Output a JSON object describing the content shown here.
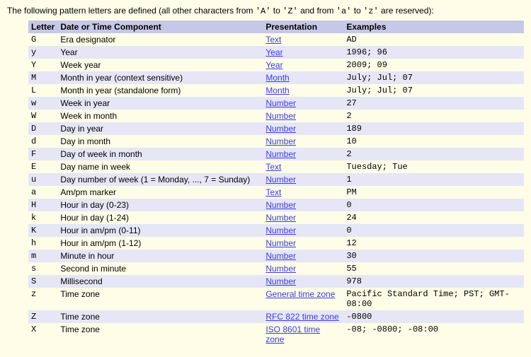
{
  "intro": {
    "prefix": "The following pattern letters are defined (all other characters from ",
    "code1": "'A'",
    "mid1": " to ",
    "code2": "'Z'",
    "mid2": " and from ",
    "code3": "'a'",
    "mid3": " to ",
    "code4": "'z'",
    "suffix": " are reserved):"
  },
  "headers": {
    "letter": "Letter",
    "desc": "Date or Time Component",
    "pres": "Presentation",
    "ex": "Examples"
  },
  "rows": [
    {
      "letter": "G",
      "desc": "Era designator",
      "pres": "Text",
      "ex": "AD"
    },
    {
      "letter": "y",
      "desc": "Year",
      "pres": "Year",
      "ex": "1996; 96"
    },
    {
      "letter": "Y",
      "desc": "Week year",
      "pres": "Year",
      "ex": "2009; 09"
    },
    {
      "letter": "M",
      "desc": "Month in year (context sensitive)",
      "pres": "Month",
      "ex": "July; Jul; 07"
    },
    {
      "letter": "L",
      "desc": "Month in year (standalone form)",
      "pres": "Month",
      "ex": "July; Jul; 07"
    },
    {
      "letter": "w",
      "desc": "Week in year",
      "pres": "Number",
      "ex": "27"
    },
    {
      "letter": "W",
      "desc": "Week in month",
      "pres": "Number",
      "ex": "2"
    },
    {
      "letter": "D",
      "desc": "Day in year",
      "pres": "Number",
      "ex": "189"
    },
    {
      "letter": "d",
      "desc": "Day in month",
      "pres": "Number",
      "ex": "10"
    },
    {
      "letter": "F",
      "desc": "Day of week in month",
      "pres": "Number",
      "ex": "2"
    },
    {
      "letter": "E",
      "desc": "Day name in week",
      "pres": "Text",
      "ex": "Tuesday; Tue"
    },
    {
      "letter": "u",
      "desc": "Day number of week (1 = Monday, ..., 7 = Sunday)",
      "pres": "Number",
      "ex": "1"
    },
    {
      "letter": "a",
      "desc": "Am/pm marker",
      "pres": "Text",
      "ex": "PM"
    },
    {
      "letter": "H",
      "desc": "Hour in day (0-23)",
      "pres": "Number",
      "ex": "0"
    },
    {
      "letter": "k",
      "desc": "Hour in day (1-24)",
      "pres": "Number",
      "ex": "24"
    },
    {
      "letter": "K",
      "desc": "Hour in am/pm (0-11)",
      "pres": "Number",
      "ex": "0"
    },
    {
      "letter": "h",
      "desc": "Hour in am/pm (1-12)",
      "pres": "Number",
      "ex": "12"
    },
    {
      "letter": "m",
      "desc": "Minute in hour",
      "pres": "Number",
      "ex": "30"
    },
    {
      "letter": "s",
      "desc": "Second in minute",
      "pres": "Number",
      "ex": "55"
    },
    {
      "letter": "S",
      "desc": "Millisecond",
      "pres": "Number",
      "ex": "978"
    },
    {
      "letter": "z",
      "desc": "Time zone",
      "pres": "General time zone",
      "ex": "Pacific Standard Time; PST; GMT-08:00"
    },
    {
      "letter": "Z",
      "desc": "Time zone",
      "pres": "RFC 822 time zone",
      "ex": "-0800"
    },
    {
      "letter": "X",
      "desc": "Time zone",
      "pres": "ISO 8601 time zone",
      "ex": "-08; -0800; -08:00"
    }
  ]
}
